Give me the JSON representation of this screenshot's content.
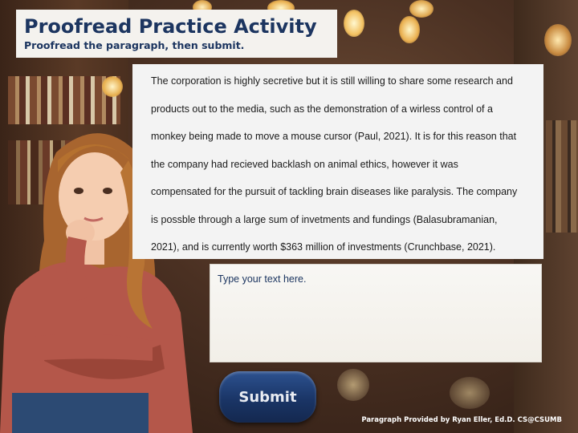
{
  "header": {
    "title": "Proofread Practice Activity",
    "subtitle": "Proofread the paragraph, then submit."
  },
  "paragraph": {
    "lines": [
      "The corporation is highly secretive but it is still willing to share some research and",
      "products out to the media, such as the demonstration of a wirless control of a",
      "monkey being made to move a mouse cursor (Paul, 2021). It is for this reason that",
      "the company had recieved backlash on animal ethics, however it was",
      "compensated for the pursuit of tackling brain diseases like paralysis. The company",
      "is possble through a large sum of invetments and fundings (Balasubramanian,",
      "2021), and is currently worth $363 million of investments (Crunchbase, 2021)."
    ]
  },
  "answer": {
    "placeholder": "Type your text here."
  },
  "submit": {
    "label": "Submit"
  },
  "footer": {
    "credit": "Paragraph Provided by Ryan Eller, Ed.D. CS@CSUMB"
  },
  "colors": {
    "title_text": "#1c3560",
    "button": "#1a3566",
    "panel": "#f3f3f3"
  },
  "icons": {
    "background": "bookshelf-bokeh-photo",
    "character": "thinking-girl-illustration"
  }
}
